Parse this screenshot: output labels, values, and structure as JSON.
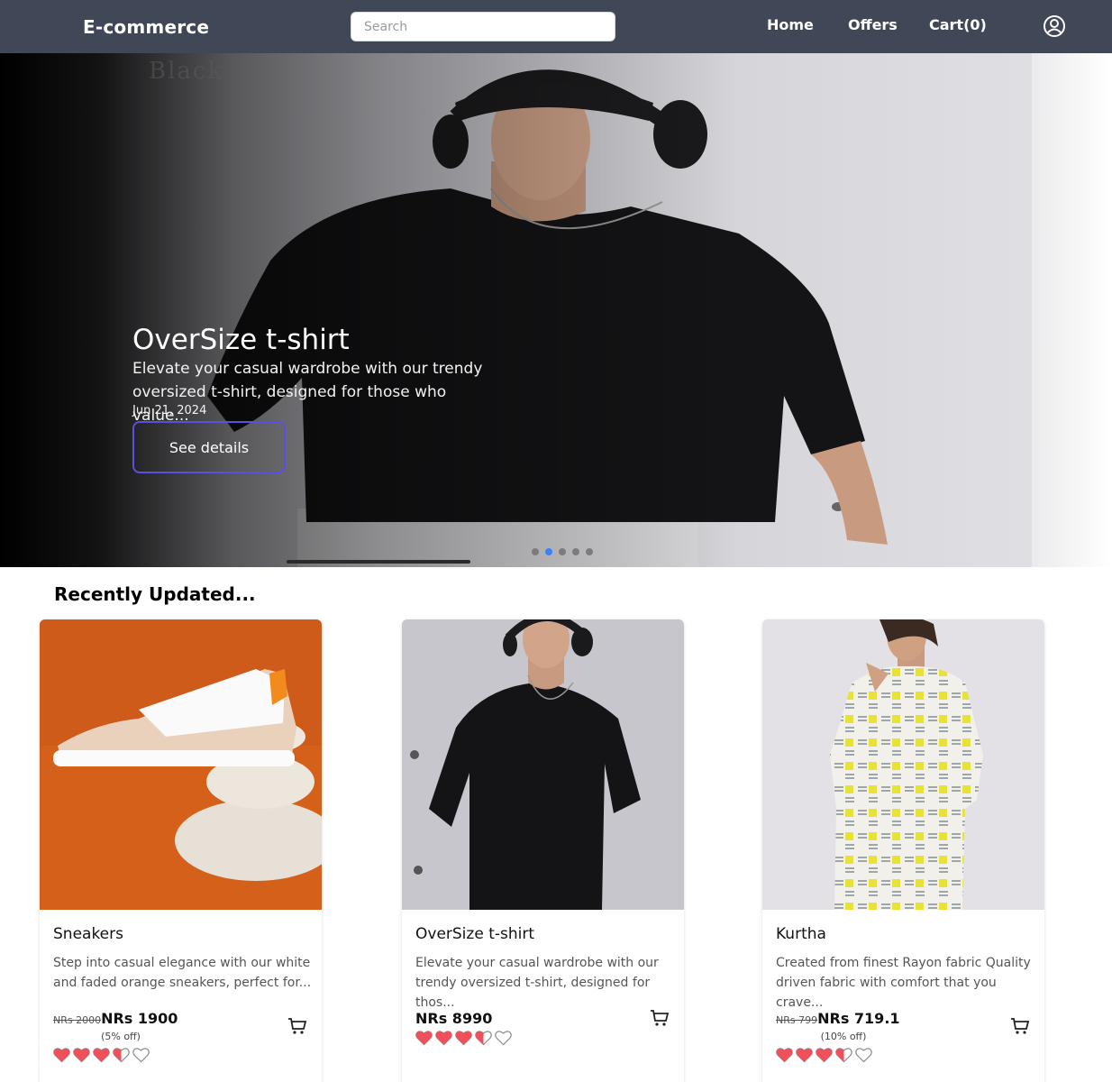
{
  "navbar": {
    "brand": "E-commerce",
    "search_placeholder": "Search",
    "links": {
      "home": "Home",
      "offers": "Offers",
      "cart": "Cart(0)"
    }
  },
  "hero": {
    "watermark": "Black",
    "title": "OverSize t-shirt",
    "description": "Elevate your casual wardrobe with our trendy oversized t-shirt, designed for those who value...",
    "date": "Jun 21, 2024",
    "button": "See details",
    "slide_count": 5,
    "active_slide": 2
  },
  "section": {
    "title": "Recently Updated..."
  },
  "products": [
    {
      "name": "Sneakers",
      "description": "Step into casual elegance with our white and faded orange sneakers, perfect for...",
      "old_price": "NRs 2000",
      "price": "NRs 1900",
      "discount": "(5% off)",
      "rating": 3.5,
      "rating_max": 5
    },
    {
      "name": "OverSize t-shirt",
      "description": "Elevate your casual wardrobe with our trendy oversized t-shirt, designed for thos...",
      "old_price": "",
      "price": "NRs 8990",
      "discount": "",
      "rating": 3.5,
      "rating_max": 5
    },
    {
      "name": "Kurtha",
      "description": "Created from finest Rayon fabric Quality driven fabric with comfort that you crave...",
      "old_price": "NRs 799",
      "price": "NRs 719.1",
      "discount": "(10% off)",
      "rating": 3.5,
      "rating_max": 5
    }
  ],
  "icons": {
    "account": "user-circle-icon",
    "cart": "shopping-cart-icon",
    "rating": "heart-icon"
  },
  "colors": {
    "navbar": "#404756",
    "button_border": "#5b4fe0",
    "heart": "#f0505a",
    "active_dot": "#3b82f6"
  }
}
